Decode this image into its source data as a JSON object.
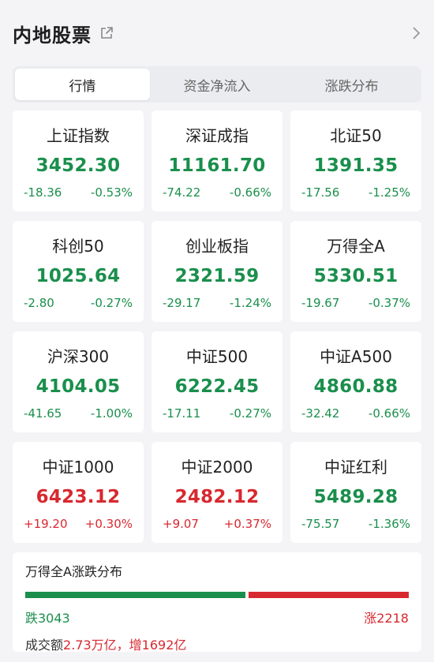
{
  "header": {
    "title": "内地股票",
    "share_icon": "share-icon",
    "chevron_icon": "chevron-right-icon"
  },
  "tabs": [
    {
      "label": "行情",
      "active": true
    },
    {
      "label": "资金净流入",
      "active": false
    },
    {
      "label": "涨跌分布",
      "active": false
    }
  ],
  "indices": [
    {
      "name": "上证指数",
      "value": "3452.30",
      "change": "-18.36",
      "pct": "-0.53%",
      "trend": "down"
    },
    {
      "name": "深证成指",
      "value": "11161.70",
      "change": "-74.22",
      "pct": "-0.66%",
      "trend": "down"
    },
    {
      "name": "北证50",
      "value": "1391.35",
      "change": "-17.56",
      "pct": "-1.25%",
      "trend": "down"
    },
    {
      "name": "科创50",
      "value": "1025.64",
      "change": "-2.80",
      "pct": "-0.27%",
      "trend": "down"
    },
    {
      "name": "创业板指",
      "value": "2321.59",
      "change": "-29.17",
      "pct": "-1.24%",
      "trend": "down"
    },
    {
      "name": "万得全A",
      "value": "5330.51",
      "change": "-19.67",
      "pct": "-0.37%",
      "trend": "down"
    },
    {
      "name": "沪深300",
      "value": "4104.05",
      "change": "-41.65",
      "pct": "-1.00%",
      "trend": "down"
    },
    {
      "name": "中证500",
      "value": "6222.45",
      "change": "-17.11",
      "pct": "-0.27%",
      "trend": "down"
    },
    {
      "name": "中证A500",
      "value": "4860.88",
      "change": "-32.42",
      "pct": "-0.66%",
      "trend": "down"
    },
    {
      "name": "中证1000",
      "value": "6423.12",
      "change": "+19.20",
      "pct": "+0.30%",
      "trend": "up"
    },
    {
      "name": "中证2000",
      "value": "2482.12",
      "change": "+9.07",
      "pct": "+0.37%",
      "trend": "up"
    },
    {
      "name": "中证红利",
      "value": "5489.28",
      "change": "-75.57",
      "pct": "-1.36%",
      "trend": "down"
    }
  ],
  "distribution": {
    "title": "万得全A涨跌分布",
    "fall_label": "跌3043",
    "rise_label": "涨2218",
    "fall_count": 3043,
    "rise_count": 2218,
    "turnover_label": "成交额",
    "turnover_value": "2.73万亿",
    "separator": "，",
    "increase_value": "增1692亿"
  },
  "colors": {
    "up": "#d8282f",
    "down": "#1a8f4c",
    "background": "#f4f4f6"
  }
}
